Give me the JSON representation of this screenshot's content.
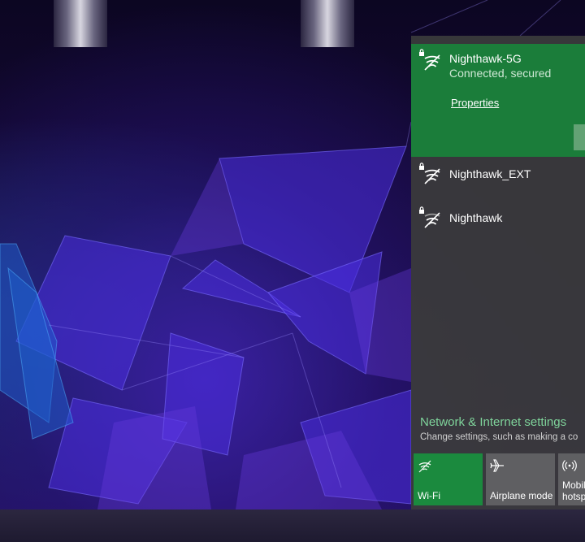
{
  "networks": [
    {
      "name": "Nighthawk-5G",
      "status": "Connected, secured",
      "properties_label": "Properties",
      "state": "connected",
      "icon": "wifi-secured-icon"
    },
    {
      "name": "Nighthawk_EXT",
      "state": "available",
      "icon": "wifi-secured-icon"
    },
    {
      "name": "Nighthawk",
      "state": "available",
      "icon": "wifi-secured-icon"
    }
  ],
  "settings": {
    "title": "Network & Internet settings",
    "description": "Change settings, such as making a co"
  },
  "quick_actions": [
    {
      "label": "Wi-Fi",
      "icon": "wifi-icon",
      "active": true
    },
    {
      "label": "Airplane mode",
      "icon": "airplane-icon",
      "active": false
    },
    {
      "label": "Mobile\nhotsp",
      "icon": "mobile-hotspot-icon",
      "active": false
    }
  ],
  "colors": {
    "accent_green": "#1b7d3a",
    "link_green": "#7fd49b",
    "flyout_bg": "#3a3a3c",
    "tile_inactive": "#5f5f62"
  }
}
